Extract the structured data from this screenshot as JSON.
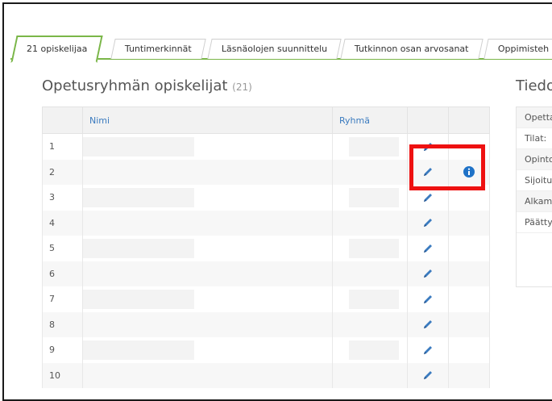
{
  "tabs": [
    {
      "label": "21 opiskelijaa",
      "active": true
    },
    {
      "label": "Tuntimerkinnät",
      "active": false
    },
    {
      "label": "Läsnäolojen suunnittelu",
      "active": false
    },
    {
      "label": "Tutkinnon osan arvosanat",
      "active": false
    },
    {
      "label": "Oppimisteh",
      "active": false
    }
  ],
  "main": {
    "title": "Opetusryhmän opiskelijat",
    "count": "(21)",
    "columns": {
      "name": "Nimi",
      "group": "Ryhmä"
    },
    "rows": [
      "1",
      "2",
      "3",
      "4",
      "5",
      "6",
      "7",
      "8",
      "9",
      "10"
    ],
    "info_row_index": 1
  },
  "side": {
    "title": "Tiedo",
    "rows": [
      "Opetta",
      "Tilat:",
      "Opinto",
      "Sijoitu",
      "Alkam",
      "Päätty"
    ]
  },
  "colors": {
    "accent": "#7ab648",
    "link": "#3b7bbf",
    "info": "#1f72c7",
    "highlight": "#ee1111"
  },
  "icons": {
    "edit": "pencil-icon",
    "info": "info-icon"
  }
}
